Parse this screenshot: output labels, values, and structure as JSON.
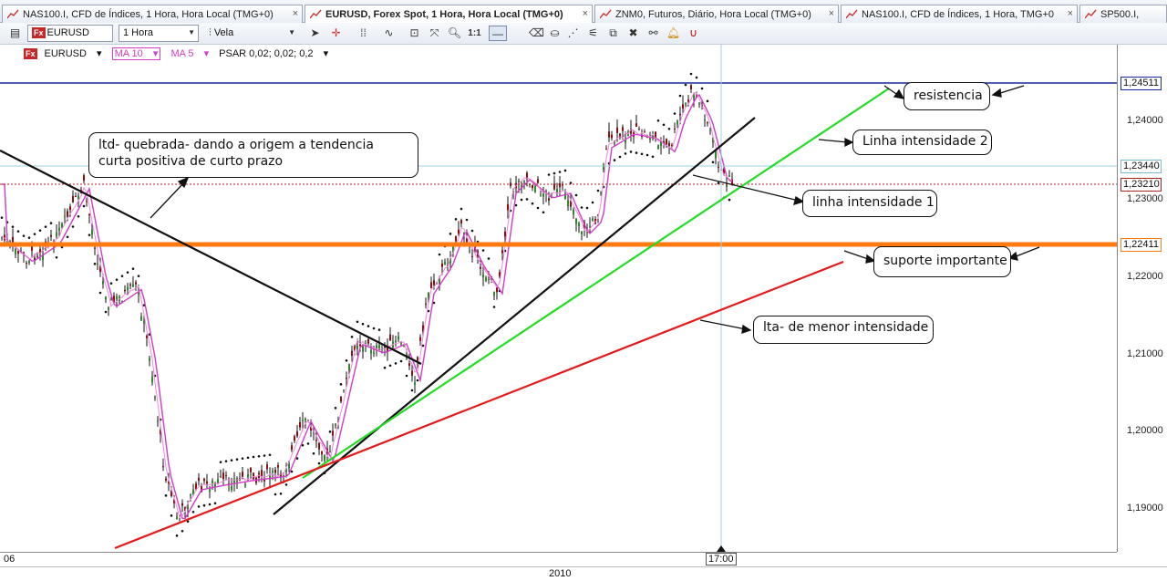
{
  "tabs": [
    {
      "label": "NAS100.I, CFD de Índices, 1 Hora, Hora Local (TMG+0)",
      "active": false
    },
    {
      "label": "EURUSD, Forex Spot, 1 Hora, Hora Local (TMG+0)",
      "active": true
    },
    {
      "label": "ZNM0, Futuros, Diário, Hora Local (TMG+0)",
      "active": false
    },
    {
      "label": "NAS100.I, CFD de Índices, 1 Hora, TMG+0",
      "active": false
    },
    {
      "label": "SP500.I,",
      "active": false
    }
  ],
  "toolbar": {
    "symbol": "EURUSD",
    "fx_badge": "Fx",
    "interval": "1 Hora",
    "chart_type": "Vela",
    "zoom_label": "1:1"
  },
  "legend": {
    "symbol": "EURUSD",
    "ma10": "MA 10",
    "ma5": "MA 5",
    "psar": "PSAR 0,02; 0,02; 0,2"
  },
  "colors": {
    "resistance": "#1a2a9c",
    "support": "#ff7a10",
    "green_line": "#22dd22",
    "red_line": "#e81818",
    "ma10": "#d23cc8",
    "current_price_line": "#aa2222"
  },
  "price_axis": {
    "ticks": [
      "1,24000",
      "1,23000",
      "1,22000",
      "1,21000",
      "1,20000",
      "1,19000"
    ],
    "tag_resistance": "1,24511",
    "tag_current": "1,23440",
    "tag_dotted": "1,23210",
    "tag_support": "1,22411"
  },
  "time_axis": {
    "left_label": "06",
    "cursor_label": "17:00",
    "year_label": "2010"
  },
  "annotations": {
    "ltd": "ltd- quebrada- dando a origem a tendencia curta positiva de curto prazo",
    "resistencia": "resistencia",
    "linha2": "Linha intensidade 2",
    "linha1": "linha intensidade 1",
    "suporte": "suporte importante",
    "lta": "lta- de menor intensidade"
  }
}
